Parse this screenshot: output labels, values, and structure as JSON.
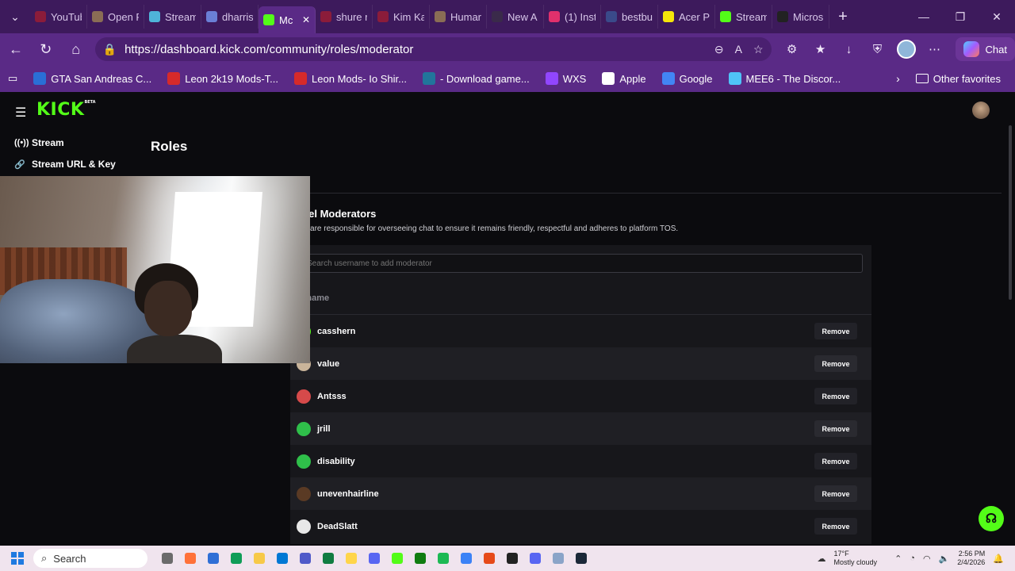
{
  "browser": {
    "tabs": [
      {
        "label": "YouTube",
        "color": "#8b1c3a"
      },
      {
        "label": "Open F",
        "color": "#8a6d55"
      },
      {
        "label": "Stream",
        "color": "#4fb3d9"
      },
      {
        "label": "dharris",
        "color": "#6a7fd6"
      },
      {
        "label": "Mc",
        "color": "#53fc18",
        "active": true
      },
      {
        "label": "shure r",
        "color": "#8b1c3a"
      },
      {
        "label": "Kim Ka",
        "color": "#8b1c3a"
      },
      {
        "label": "Humar",
        "color": "#8a6d55"
      },
      {
        "label": "New A",
        "color": "#3a2a4a"
      },
      {
        "label": "(1) Inst",
        "color": "#e1306c"
      },
      {
        "label": "bestbu",
        "color": "#3a4a8a"
      },
      {
        "label": "Acer Pr",
        "color": "#f5e60a"
      },
      {
        "label": "Stream",
        "color": "#53fc18"
      },
      {
        "label": "Micros",
        "color": "#222222"
      }
    ],
    "url": "https://dashboard.kick.com/community/roles/moderator",
    "chat_label": "Chat",
    "favorites": [
      {
        "label": "GTA San Andreas C...",
        "color": "#2a6fd6"
      },
      {
        "label": "Leon 2k19 Mods-T...",
        "color": "#d62a2a"
      },
      {
        "label": "Leon Mods- Io Shir...",
        "color": "#d62a2a"
      },
      {
        "label": "- Download game...",
        "color": "#21759b"
      },
      {
        "label": "WXS",
        "color": "#9146ff"
      },
      {
        "label": "Apple",
        "color": "#ffffff"
      },
      {
        "label": "Google",
        "color": "#4285f4"
      },
      {
        "label": "MEE6 - The Discor...",
        "color": "#4fc3f7"
      }
    ],
    "other_favorites": "Other favorites"
  },
  "app": {
    "logo": "KICK",
    "logo_badge": "BETA",
    "sidebar": [
      {
        "label": "Stream",
        "icon": "broadcast-icon"
      },
      {
        "label": "Stream URL & Key",
        "icon": "link-icon"
      }
    ],
    "page_title": "Roles",
    "section_title": "annel Moderators",
    "section_desc": "ators are responsible for overseeing chat to ensure it remains friendly, respectful and adheres to platform TOS.",
    "search_placeholder": "Search username to add moderator",
    "column_header": "ername",
    "remove_label": "Remove",
    "moderators": [
      {
        "name": "casshern",
        "avatar": "#53fc18"
      },
      {
        "name": "value",
        "avatar": "#c9b49a"
      },
      {
        "name": "Antsss",
        "avatar": "#d64a4a"
      },
      {
        "name": "jrill",
        "avatar": "#2fbf4a"
      },
      {
        "name": "disability",
        "avatar": "#2fbf4a"
      },
      {
        "name": "unevenhairline",
        "avatar": "#5a3a24"
      },
      {
        "name": "DeadSlatt",
        "avatar": "#e8e8e8"
      }
    ]
  },
  "taskbar": {
    "search": "Search",
    "weather_temp": "17°F",
    "weather_desc": "Mostly cloudy",
    "time": "2:56 PM",
    "date": "2/4/2026",
    "icons": [
      "#6b6b6b",
      "#ff7139",
      "#2f6fd6",
      "#0f9d58",
      "#f7c948",
      "#0078d4",
      "#5059c9",
      "#107c41",
      "#ffd54a",
      "#5865f2",
      "#53fc18",
      "#107c10",
      "#1db954",
      "#3c82f6",
      "#e64a19",
      "#222222",
      "#5865f2",
      "#8aa4c8",
      "#1b2838"
    ]
  }
}
